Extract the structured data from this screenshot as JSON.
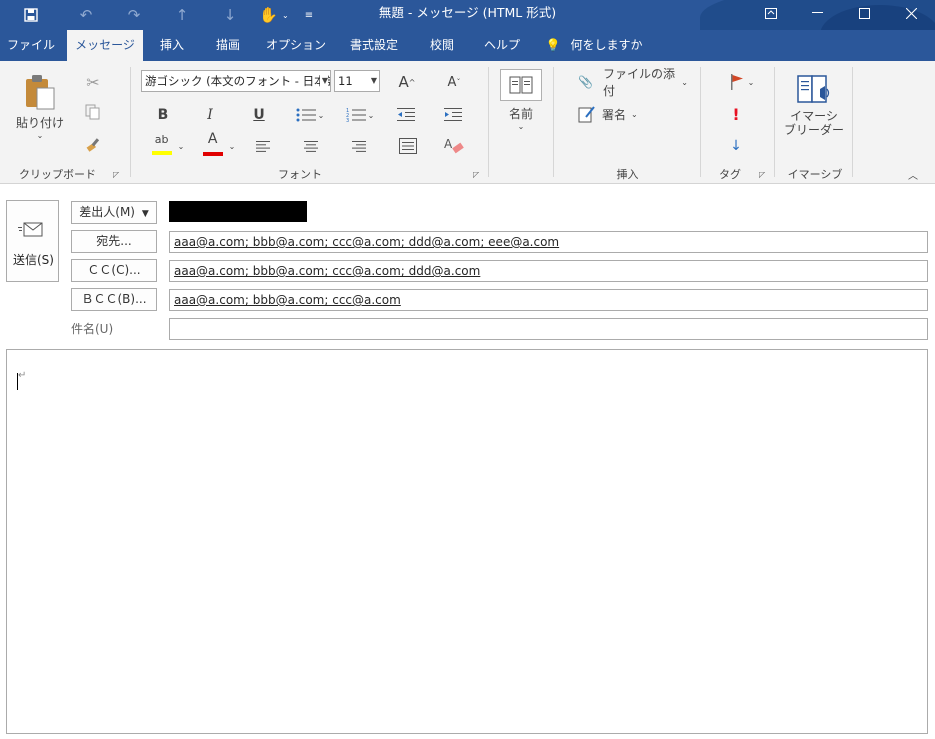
{
  "window": {
    "title": "無題 - メッセージ (HTML 形式)"
  },
  "tabs": [
    {
      "label": "ファイル"
    },
    {
      "label": "メッセージ"
    },
    {
      "label": "挿入"
    },
    {
      "label": "描画"
    },
    {
      "label": "オプション"
    },
    {
      "label": "書式設定"
    },
    {
      "label": "校閲"
    },
    {
      "label": "ヘルプ"
    },
    {
      "label": "何をしますか"
    }
  ],
  "ribbon": {
    "clipboard": {
      "paste_label": "貼り付け",
      "group_label": "クリップボード"
    },
    "font": {
      "font_name": "游ゴシック (本文のフォント - 日本語)",
      "font_size": "11",
      "group_label": "フォント",
      "bold": "B",
      "italic": "I",
      "underline": "U"
    },
    "names": {
      "label": "名前"
    },
    "insert": {
      "attach_label": "ファイルの添付",
      "signature_label": "署名",
      "group_label": "挿入"
    },
    "tags": {
      "group_label": "タグ"
    },
    "immersive": {
      "reader_label_1": "イマーシ",
      "reader_label_2": "ブリーダー",
      "group_label": "イマーシブ"
    }
  },
  "compose": {
    "send_label": "送信(S)",
    "from_label": "差出人(M)",
    "to_label": "宛先...",
    "cc_label": "ＣＣ(C)...",
    "bcc_label": "ＢＣＣ(B)...",
    "subject_label": "件名(U)",
    "to_value": "aaa@a.com; bbb@a.com; ccc@a.com; ddd@a.com; eee@a.com",
    "cc_value": "aaa@a.com; bbb@a.com; ccc@a.com; ddd@a.com",
    "bcc_value": "aaa@a.com; bbb@a.com; ccc@a.com",
    "subject_value": "",
    "body_mark": "↵"
  },
  "colors": {
    "accent": "#2b579a",
    "highlight_yellow": "#ffff00",
    "font_red": "#e00000",
    "flag_red": "#d24726"
  }
}
